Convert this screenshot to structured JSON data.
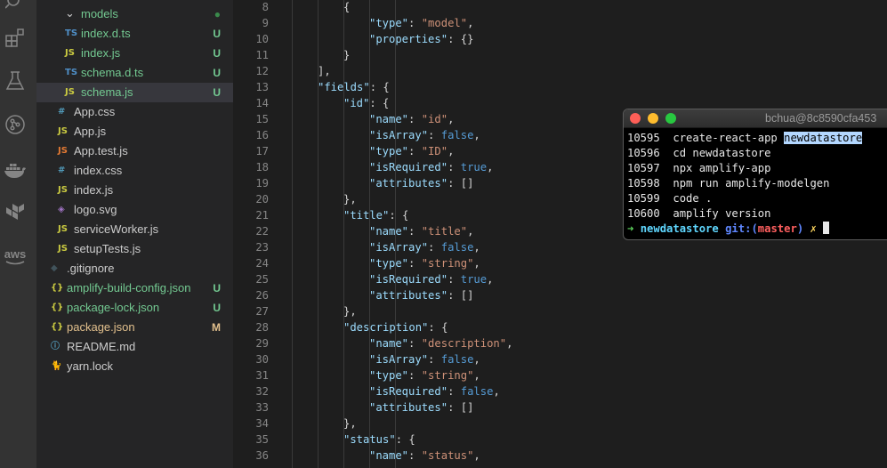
{
  "activity_bar": {
    "icons": [
      "search-icon",
      "extensions-icon",
      "testing-icon",
      "git-graph-icon",
      "docker-icon",
      "terraform-icon",
      "aws-icon"
    ],
    "aws_label": "aws"
  },
  "explorer": {
    "rows": [
      {
        "indent": 1,
        "chevron": "⌄",
        "icon": "",
        "name": "models",
        "badge": "●",
        "kind": "folder",
        "color": "#73c991",
        "badge_color": "#3a8a4b"
      },
      {
        "indent": 2,
        "icon": "TS",
        "icon_color": "#4f8fc7",
        "name": "index.d.ts",
        "badge": "U",
        "color": "#73c991"
      },
      {
        "indent": 2,
        "icon": "JS",
        "icon_color": "#cbcb41",
        "name": "index.js",
        "badge": "U",
        "color": "#73c991"
      },
      {
        "indent": 2,
        "icon": "TS",
        "icon_color": "#4f8fc7",
        "name": "schema.d.ts",
        "badge": "U",
        "color": "#73c991"
      },
      {
        "indent": 2,
        "icon": "JS",
        "icon_color": "#cbcb41",
        "name": "schema.js",
        "badge": "U",
        "color": "#73c991",
        "selected": true
      },
      {
        "indent": 1,
        "icon": "#",
        "icon_color": "#519aba",
        "name": "App.css",
        "badge": "",
        "color": "#cccccc"
      },
      {
        "indent": 1,
        "icon": "JS",
        "icon_color": "#cbcb41",
        "name": "App.js",
        "badge": "",
        "color": "#cccccc"
      },
      {
        "indent": 1,
        "icon": "JS",
        "icon_color": "#e37933",
        "name": "App.test.js",
        "badge": "",
        "color": "#cccccc"
      },
      {
        "indent": 1,
        "icon": "#",
        "icon_color": "#519aba",
        "name": "index.css",
        "badge": "",
        "color": "#cccccc"
      },
      {
        "indent": 1,
        "icon": "JS",
        "icon_color": "#cbcb41",
        "name": "index.js",
        "badge": "",
        "color": "#cccccc"
      },
      {
        "indent": 1,
        "icon": "◈",
        "icon_color": "#a074c4",
        "name": "logo.svg",
        "badge": "",
        "color": "#cccccc"
      },
      {
        "indent": 1,
        "icon": "JS",
        "icon_color": "#cbcb41",
        "name": "serviceWorker.js",
        "badge": "",
        "color": "#cccccc"
      },
      {
        "indent": 1,
        "icon": "JS",
        "icon_color": "#cbcb41",
        "name": "setupTests.js",
        "badge": "",
        "color": "#cccccc"
      },
      {
        "indent": 0,
        "icon": "◆",
        "icon_color": "#41535b",
        "name": ".gitignore",
        "badge": "",
        "color": "#cccccc"
      },
      {
        "indent": 0,
        "icon": "{}",
        "icon_color": "#cbcb41",
        "name": "amplify-build-config.json",
        "badge": "U",
        "color": "#73c991"
      },
      {
        "indent": 0,
        "icon": "{}",
        "icon_color": "#cbcb41",
        "name": "package-lock.json",
        "badge": "U",
        "color": "#73c991"
      },
      {
        "indent": 0,
        "icon": "{}",
        "icon_color": "#cbcb41",
        "name": "package.json",
        "badge": "M",
        "color": "#e2c08d"
      },
      {
        "indent": 0,
        "icon": "ⓘ",
        "icon_color": "#519aba",
        "name": "README.md",
        "badge": "",
        "color": "#cccccc"
      },
      {
        "indent": 0,
        "icon": "🐈",
        "icon_color": "#2c8ebb",
        "name": "yarn.lock",
        "badge": "",
        "color": "#cccccc"
      }
    ]
  },
  "editor": {
    "lines": [
      {
        "n": "8",
        "indent": 4,
        "tokens": [
          [
            "{",
            "punc"
          ]
        ]
      },
      {
        "n": "9",
        "indent": 5,
        "tokens": [
          [
            "\"type\"",
            "key"
          ],
          [
            ": ",
            "punc"
          ],
          [
            "\"model\"",
            "str"
          ],
          [
            ",",
            "punc"
          ]
        ]
      },
      {
        "n": "10",
        "indent": 5,
        "tokens": [
          [
            "\"properties\"",
            "key"
          ],
          [
            ": {}",
            "punc"
          ]
        ]
      },
      {
        "n": "11",
        "indent": 4,
        "tokens": [
          [
            "}",
            "punc"
          ]
        ]
      },
      {
        "n": "12",
        "indent": 3,
        "tokens": [
          [
            "],",
            "punc"
          ]
        ]
      },
      {
        "n": "13",
        "indent": 3,
        "tokens": [
          [
            "\"fields\"",
            "key"
          ],
          [
            ": {",
            "punc"
          ]
        ]
      },
      {
        "n": "14",
        "indent": 4,
        "tokens": [
          [
            "\"id\"",
            "key"
          ],
          [
            ": {",
            "punc"
          ]
        ]
      },
      {
        "n": "15",
        "indent": 5,
        "tokens": [
          [
            "\"name\"",
            "key"
          ],
          [
            ": ",
            "punc"
          ],
          [
            "\"id\"",
            "str"
          ],
          [
            ",",
            "punc"
          ]
        ]
      },
      {
        "n": "16",
        "indent": 5,
        "tokens": [
          [
            "\"isArray\"",
            "key"
          ],
          [
            ": ",
            "punc"
          ],
          [
            "false",
            "bool"
          ],
          [
            ",",
            "punc"
          ]
        ]
      },
      {
        "n": "17",
        "indent": 5,
        "tokens": [
          [
            "\"type\"",
            "key"
          ],
          [
            ": ",
            "punc"
          ],
          [
            "\"ID\"",
            "str"
          ],
          [
            ",",
            "punc"
          ]
        ]
      },
      {
        "n": "18",
        "indent": 5,
        "tokens": [
          [
            "\"isRequired\"",
            "key"
          ],
          [
            ": ",
            "punc"
          ],
          [
            "true",
            "bool"
          ],
          [
            ",",
            "punc"
          ]
        ]
      },
      {
        "n": "19",
        "indent": 5,
        "tokens": [
          [
            "\"attributes\"",
            "key"
          ],
          [
            ": []",
            "punc"
          ]
        ]
      },
      {
        "n": "20",
        "indent": 4,
        "tokens": [
          [
            "},",
            "punc"
          ]
        ]
      },
      {
        "n": "21",
        "indent": 4,
        "tokens": [
          [
            "\"title\"",
            "key"
          ],
          [
            ": {",
            "punc"
          ]
        ]
      },
      {
        "n": "22",
        "indent": 5,
        "tokens": [
          [
            "\"name\"",
            "key"
          ],
          [
            ": ",
            "punc"
          ],
          [
            "\"title\"",
            "str"
          ],
          [
            ",",
            "punc"
          ]
        ]
      },
      {
        "n": "23",
        "indent": 5,
        "tokens": [
          [
            "\"isArray\"",
            "key"
          ],
          [
            ": ",
            "punc"
          ],
          [
            "false",
            "bool"
          ],
          [
            ",",
            "punc"
          ]
        ]
      },
      {
        "n": "24",
        "indent": 5,
        "tokens": [
          [
            "\"type\"",
            "key"
          ],
          [
            ": ",
            "punc"
          ],
          [
            "\"string\"",
            "str"
          ],
          [
            ",",
            "punc"
          ]
        ]
      },
      {
        "n": "25",
        "indent": 5,
        "tokens": [
          [
            "\"isRequired\"",
            "key"
          ],
          [
            ": ",
            "punc"
          ],
          [
            "true",
            "bool"
          ],
          [
            ",",
            "punc"
          ]
        ]
      },
      {
        "n": "26",
        "indent": 5,
        "tokens": [
          [
            "\"attributes\"",
            "key"
          ],
          [
            ": []",
            "punc"
          ]
        ]
      },
      {
        "n": "27",
        "indent": 4,
        "tokens": [
          [
            "},",
            "punc"
          ]
        ]
      },
      {
        "n": "28",
        "indent": 4,
        "tokens": [
          [
            "\"description\"",
            "key"
          ],
          [
            ": {",
            "punc"
          ]
        ]
      },
      {
        "n": "29",
        "indent": 5,
        "tokens": [
          [
            "\"name\"",
            "key"
          ],
          [
            ": ",
            "punc"
          ],
          [
            "\"description\"",
            "str"
          ],
          [
            ",",
            "punc"
          ]
        ]
      },
      {
        "n": "30",
        "indent": 5,
        "tokens": [
          [
            "\"isArray\"",
            "key"
          ],
          [
            ": ",
            "punc"
          ],
          [
            "false",
            "bool"
          ],
          [
            ",",
            "punc"
          ]
        ]
      },
      {
        "n": "31",
        "indent": 5,
        "tokens": [
          [
            "\"type\"",
            "key"
          ],
          [
            ": ",
            "punc"
          ],
          [
            "\"string\"",
            "str"
          ],
          [
            ",",
            "punc"
          ]
        ]
      },
      {
        "n": "32",
        "indent": 5,
        "tokens": [
          [
            "\"isRequired\"",
            "key"
          ],
          [
            ": ",
            "punc"
          ],
          [
            "false",
            "bool"
          ],
          [
            ",",
            "punc"
          ]
        ]
      },
      {
        "n": "33",
        "indent": 5,
        "tokens": [
          [
            "\"attributes\"",
            "key"
          ],
          [
            ": []",
            "punc"
          ]
        ]
      },
      {
        "n": "34",
        "indent": 4,
        "tokens": [
          [
            "},",
            "punc"
          ]
        ]
      },
      {
        "n": "35",
        "indent": 4,
        "tokens": [
          [
            "\"status\"",
            "key"
          ],
          [
            ": {",
            "punc"
          ]
        ]
      },
      {
        "n": "36",
        "indent": 5,
        "tokens": [
          [
            "\"name\"",
            "key"
          ],
          [
            ": ",
            "punc"
          ],
          [
            "\"status\"",
            "str"
          ],
          [
            ",",
            "punc"
          ]
        ]
      }
    ],
    "colors": {
      "punc": "#d4d4d4",
      "key": "#9cdcfe",
      "str": "#ce9178",
      "bool": "#569cd6"
    }
  },
  "terminal": {
    "title": "bchua@8c8590cfa453",
    "history": [
      {
        "num": "10595",
        "cmd": "create-react-app ",
        "highlight": "newdatastore"
      },
      {
        "num": "10596",
        "cmd": "cd newdatastore",
        "highlight": ""
      },
      {
        "num": "10597",
        "cmd": "npx amplify-app",
        "highlight": ""
      },
      {
        "num": "10598",
        "cmd": "npm run amplify-modelgen",
        "highlight": ""
      },
      {
        "num": "10599",
        "cmd": "code .",
        "highlight": ""
      },
      {
        "num": "10600",
        "cmd": "amplify version",
        "highlight": ""
      }
    ],
    "prompt": {
      "arrow": "➜",
      "dir": "newdatastore",
      "git_prefix": "git:(",
      "branch": "master",
      "git_suffix": ")",
      "dirty": "✗"
    },
    "traffic_lights": [
      "#fe5f57",
      "#febc2e",
      "#28c840"
    ]
  }
}
